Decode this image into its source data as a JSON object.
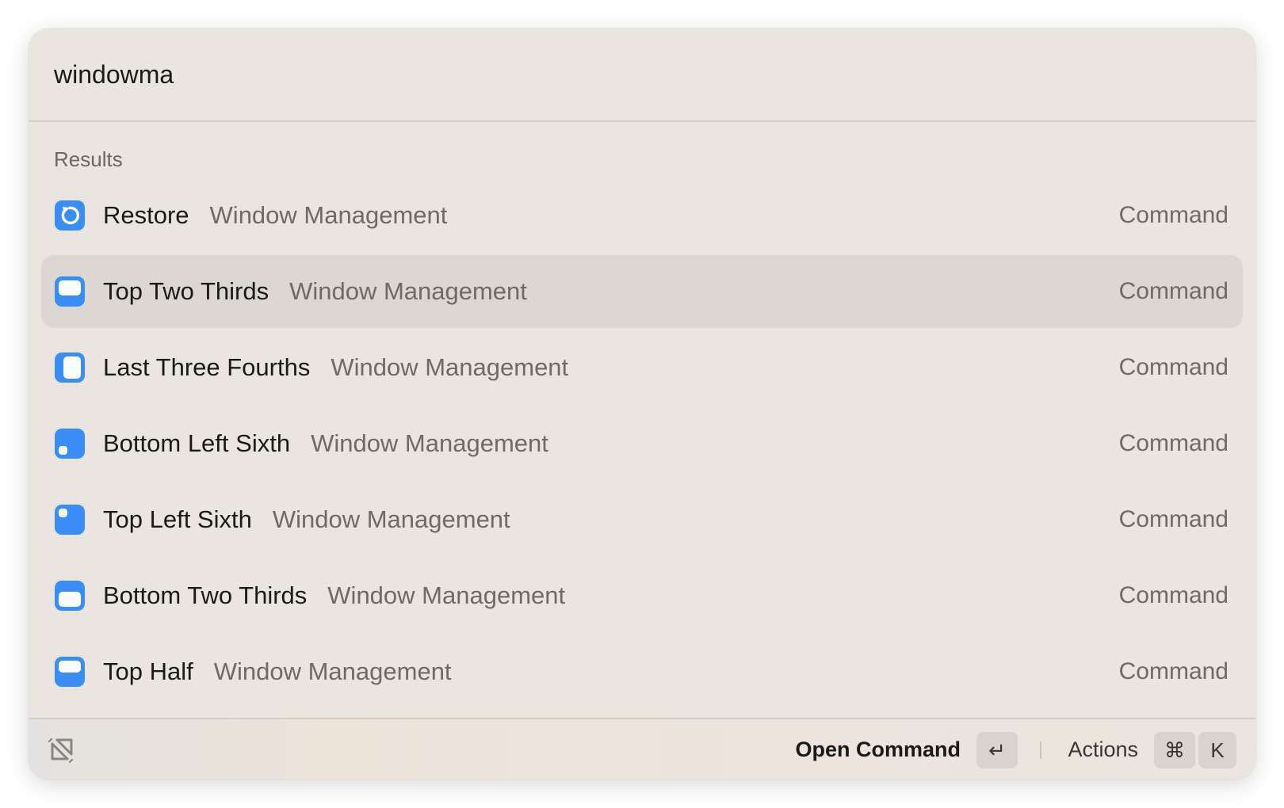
{
  "search": {
    "value": "windowma"
  },
  "section": {
    "label": "Results"
  },
  "results": [
    {
      "title": "Restore",
      "subtitle": "Window Management",
      "type": "Command",
      "icon": "restore-icon",
      "selected": false
    },
    {
      "title": "Top Two Thirds",
      "subtitle": "Window Management",
      "type": "Command",
      "icon": "top-two-thirds-icon",
      "selected": true
    },
    {
      "title": "Last Three Fourths",
      "subtitle": "Window Management",
      "type": "Command",
      "icon": "last-three-fourths-icon",
      "selected": false
    },
    {
      "title": "Bottom Left Sixth",
      "subtitle": "Window Management",
      "type": "Command",
      "icon": "bottom-left-sixth-icon",
      "selected": false
    },
    {
      "title": "Top Left Sixth",
      "subtitle": "Window Management",
      "type": "Command",
      "icon": "top-left-sixth-icon",
      "selected": false
    },
    {
      "title": "Bottom Two Thirds",
      "subtitle": "Window Management",
      "type": "Command",
      "icon": "bottom-two-thirds-icon",
      "selected": false
    },
    {
      "title": "Top Half",
      "subtitle": "Window Management",
      "type": "Command",
      "icon": "top-half-icon",
      "selected": false
    }
  ],
  "footer": {
    "logo_icon": "raycast-logo-icon",
    "primary_action": "Open Command",
    "enter_key": "↵",
    "actions_label": "Actions",
    "cmd_key": "⌘",
    "k_key": "K"
  },
  "colors": {
    "accent": "#3b8cf5",
    "background": "#eae5df",
    "selected_row": "#dcd7d2"
  }
}
